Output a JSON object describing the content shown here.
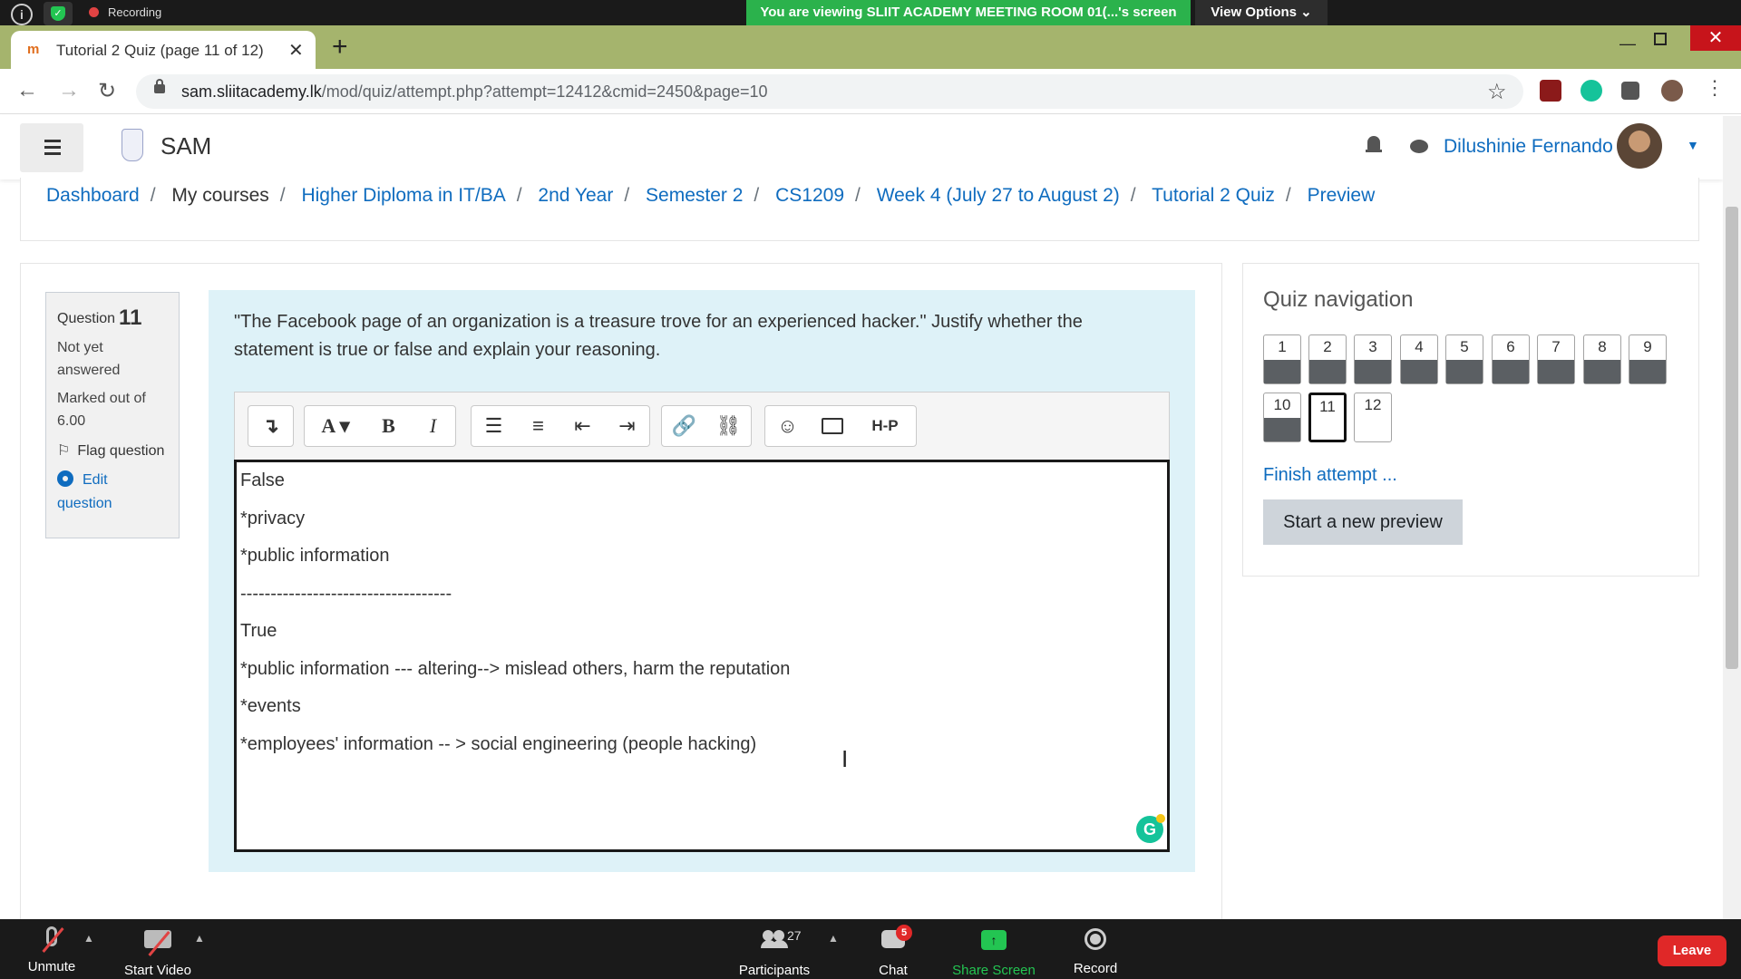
{
  "zoom_top": {
    "recording_label": "Recording",
    "viewing_label": "You are viewing SLIIT ACADEMY MEETING ROOM 01(...'s screen",
    "view_options_label": "View Options ⌄"
  },
  "browser": {
    "tab_title": "Tutorial 2 Quiz (page 11 of 12)",
    "new_tab_glyph": "+",
    "url_host": "sam.sliitacademy.lk",
    "url_path": "/mod/quiz/attempt.php?attempt=12412&cmid=2450&page=10"
  },
  "site": {
    "name": "SAM",
    "user_name": "Dilushinie Fernando"
  },
  "breadcrumb": [
    "Dashboard",
    "My courses",
    "Higher Diploma in IT/BA",
    "2nd Year",
    "Semester 2",
    "CS1209",
    "Week 4 (July 27 to August 2)",
    "Tutorial 2 Quiz",
    "Preview"
  ],
  "question_info": {
    "label": "Question",
    "number": "11",
    "status_1": "Not yet",
    "status_2": "answered",
    "marks_1": "Marked out of",
    "marks_2": "6.00",
    "flag_label": "Flag question",
    "edit_1": "Edit",
    "edit_2": "question"
  },
  "question": {
    "text": "\"The Facebook page of an organization is a treasure trove for an experienced hacker.\" Justify whether the statement is true or false and explain your reasoning."
  },
  "editor": {
    "toolbar": {
      "collapse": "↴",
      "font": "A ▾",
      "bold": "B",
      "italic": "I",
      "link": "🔗",
      "unlink": "⛓",
      "emoji": "☺",
      "h5p": "H-P"
    },
    "lines": [
      "False",
      "*privacy",
      "*public information",
      "-----------------------------------",
      "True",
      "*public information --- altering--> mislead others, harm the reputation",
      "*events",
      "*employees' information -- > social engineering (people hacking)"
    ]
  },
  "quiz_nav": {
    "title": "Quiz navigation",
    "buttons": [
      "1",
      "2",
      "3",
      "4",
      "5",
      "6",
      "7",
      "8",
      "9",
      "10",
      "11",
      "12"
    ],
    "finish_label": "Finish attempt ...",
    "new_preview_label": "Start a new preview"
  },
  "zoom_bottom": {
    "unmute": "Unmute",
    "start_video": "Start Video",
    "participants_count": "27",
    "participants": "Participants",
    "chat": "Chat",
    "chat_badge": "5",
    "share_screen": "Share Screen",
    "record": "Record",
    "leave": "Leave"
  }
}
